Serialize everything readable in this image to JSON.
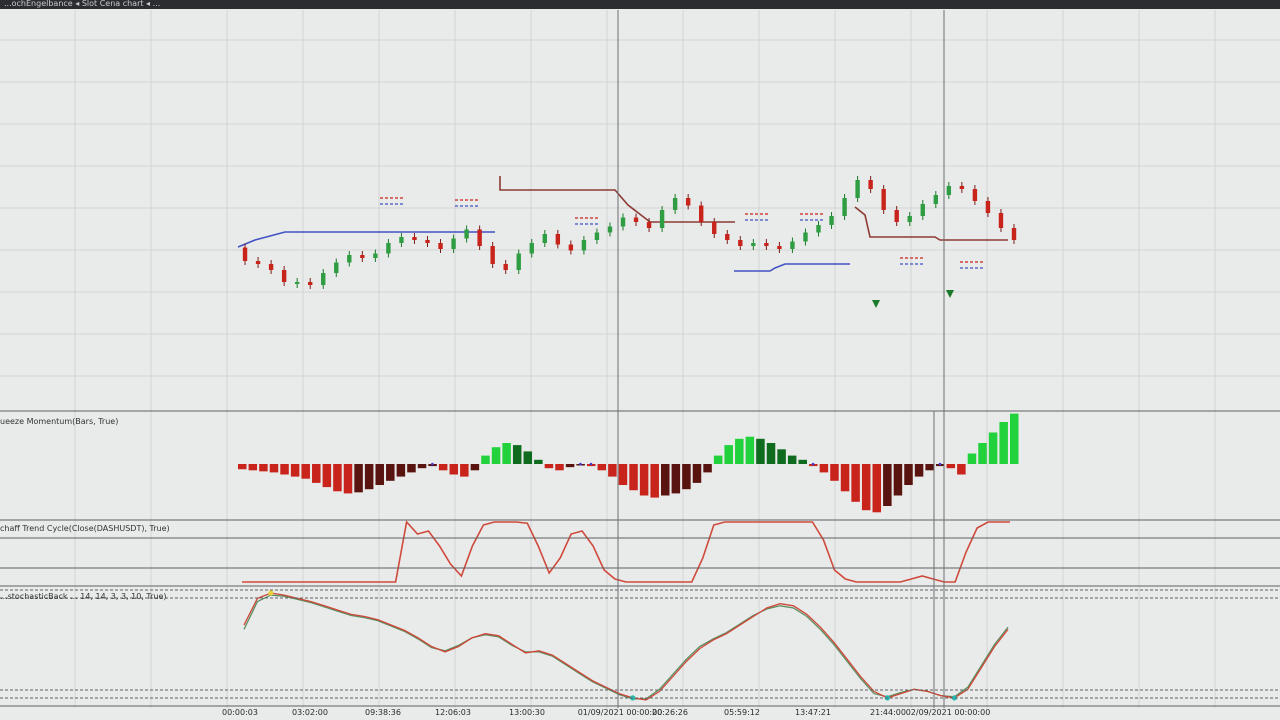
{
  "window": {
    "title": "...ochEngelbance ◂ Slot Cena chart ◂ ..."
  },
  "panes": {
    "squeeze": {
      "label": "ueeze Momentum(Bars, True)"
    },
    "schaff": {
      "label": "chaff Trend Cycle(Close(DASHUSDT), True)"
    },
    "stochrsi": {
      "label": "...stochasticBack ... 14, 14, 3, 3, 10, True)"
    }
  },
  "time_axis": {
    "ticks": [
      "00:00:03",
      "03:02:00",
      "09:38:36",
      "12:06:03",
      "13:00:30",
      "01/09/2021 00:00:00",
      "20:26:26",
      "05:59:12",
      "13:47:21",
      "21:44:00",
      "02/09/2021 00:00:00"
    ]
  },
  "colors": {
    "background": "#e9eaea",
    "grid": "#d3d5d5",
    "divider": "#5e6063",
    "bull": "#1fc33a",
    "bear": "#c9241c",
    "support_line": "#4252c4",
    "resistance_line": "#8c3a33",
    "schaff_line": "#d04a3c",
    "stoch_k": "#cf4636",
    "stoch_d": "#5b8f62",
    "signal_dot": "#27b9b0",
    "signal_dot_top": "#e8d13a"
  },
  "chart_data": {
    "type": "line",
    "main_series": [
      35,
      26,
      24,
      20,
      12,
      12,
      10,
      18,
      25,
      30,
      28,
      31,
      38,
      42,
      40,
      38,
      34,
      41,
      47,
      36,
      24,
      20,
      31,
      38,
      44,
      37,
      33,
      40,
      45,
      49,
      55,
      52,
      48,
      60,
      68,
      63,
      52,
      44,
      40,
      36,
      38,
      36,
      34,
      39,
      45,
      50,
      56,
      68,
      80,
      74,
      60,
      52,
      56,
      64,
      70,
      76,
      74,
      66,
      58,
      48,
      40
    ],
    "squeeze_momentum": [
      -5,
      -6,
      -7,
      -8,
      -10,
      -12,
      -14,
      -18,
      -22,
      -26,
      -28,
      -27,
      -24,
      -20,
      -16,
      -12,
      -8,
      -4,
      -2,
      -6,
      -10,
      -12,
      -6,
      8,
      16,
      20,
      18,
      12,
      4,
      -4,
      -6,
      -3,
      -1,
      -2,
      -6,
      -12,
      -20,
      -25,
      -30,
      -32,
      -30,
      -28,
      -24,
      -18,
      -8,
      8,
      18,
      24,
      26,
      24,
      20,
      14,
      8,
      4,
      -2,
      -8,
      -16,
      -26,
      -36,
      -44,
      -46,
      -40,
      -30,
      -20,
      -12,
      -6,
      -2,
      -4,
      -10,
      10,
      20,
      30,
      40,
      48
    ],
    "schaff_trend_cycle": [
      0,
      0,
      0,
      0,
      0,
      0,
      0,
      0,
      0,
      0,
      0,
      0,
      0,
      0,
      0,
      100,
      80,
      85,
      60,
      30,
      10,
      60,
      95,
      100,
      100,
      100,
      98,
      60,
      15,
      40,
      80,
      85,
      60,
      20,
      5,
      0,
      0,
      0,
      0,
      0,
      0,
      0,
      40,
      95,
      100,
      100,
      100,
      100,
      100,
      100,
      100,
      100,
      100,
      70,
      20,
      5,
      0,
      0,
      0,
      0,
      0,
      5,
      10,
      5,
      0,
      0,
      50,
      90,
      100,
      100,
      100
    ],
    "stochastic_k": [
      70,
      95,
      100,
      98,
      95,
      92,
      88,
      84,
      80,
      78,
      75,
      70,
      65,
      58,
      50,
      45,
      50,
      58,
      62,
      60,
      52,
      44,
      46,
      42,
      34,
      26,
      18,
      12,
      6,
      2,
      0,
      8,
      22,
      36,
      48,
      56,
      62,
      70,
      78,
      86,
      90,
      88,
      80,
      68,
      54,
      38,
      22,
      8,
      2,
      6,
      10,
      8,
      4,
      2,
      10,
      30,
      50,
      66
    ],
    "stochastic_d": [
      66,
      92,
      98,
      97,
      94,
      91,
      87,
      83,
      79,
      77,
      74,
      69,
      64,
      57,
      49,
      46,
      51,
      58,
      61,
      59,
      51,
      45,
      45,
      41,
      33,
      25,
      17,
      11,
      5,
      1,
      1,
      10,
      24,
      38,
      50,
      57,
      63,
      71,
      79,
      85,
      88,
      86,
      78,
      66,
      52,
      36,
      20,
      6,
      3,
      7,
      10,
      8,
      4,
      3,
      12,
      32,
      52,
      68
    ]
  }
}
